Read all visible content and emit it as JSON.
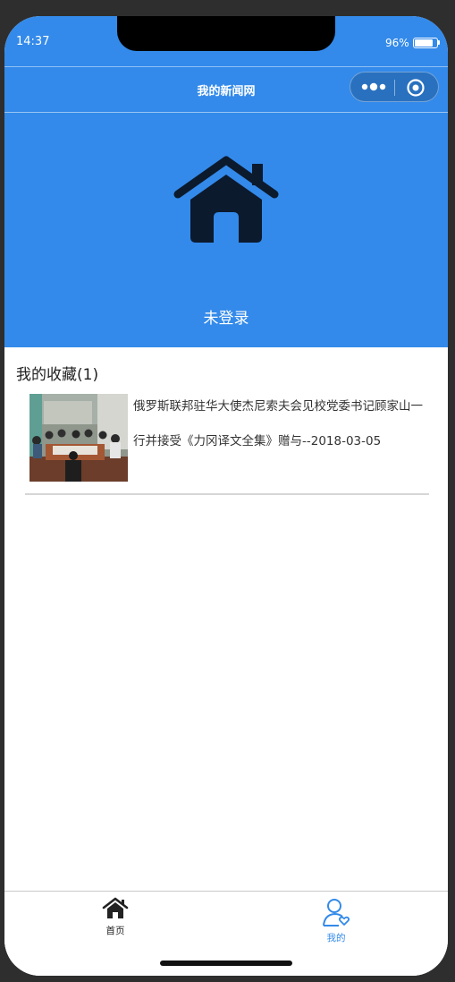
{
  "status_bar": {
    "time": "14:37",
    "battery": "96%",
    "battery_level": 0.96
  },
  "nav": {
    "title": "我的新闻网"
  },
  "profile": {
    "login_status": "未登录"
  },
  "favorites": {
    "title": "我的收藏(1)",
    "items": [
      {
        "title": "俄罗斯联邦驻华大使杰尼索夫会见校党委书记顾家山一行并接受《力冈译文全集》赠与--2018-03-05"
      }
    ]
  },
  "tabbar": {
    "tabs": [
      {
        "label": "首页",
        "icon": "home-icon"
      },
      {
        "label": "我的",
        "icon": "user-heart-icon"
      }
    ]
  },
  "colors": {
    "primary": "#338aea",
    "header_icon": "#0c1a2e"
  }
}
